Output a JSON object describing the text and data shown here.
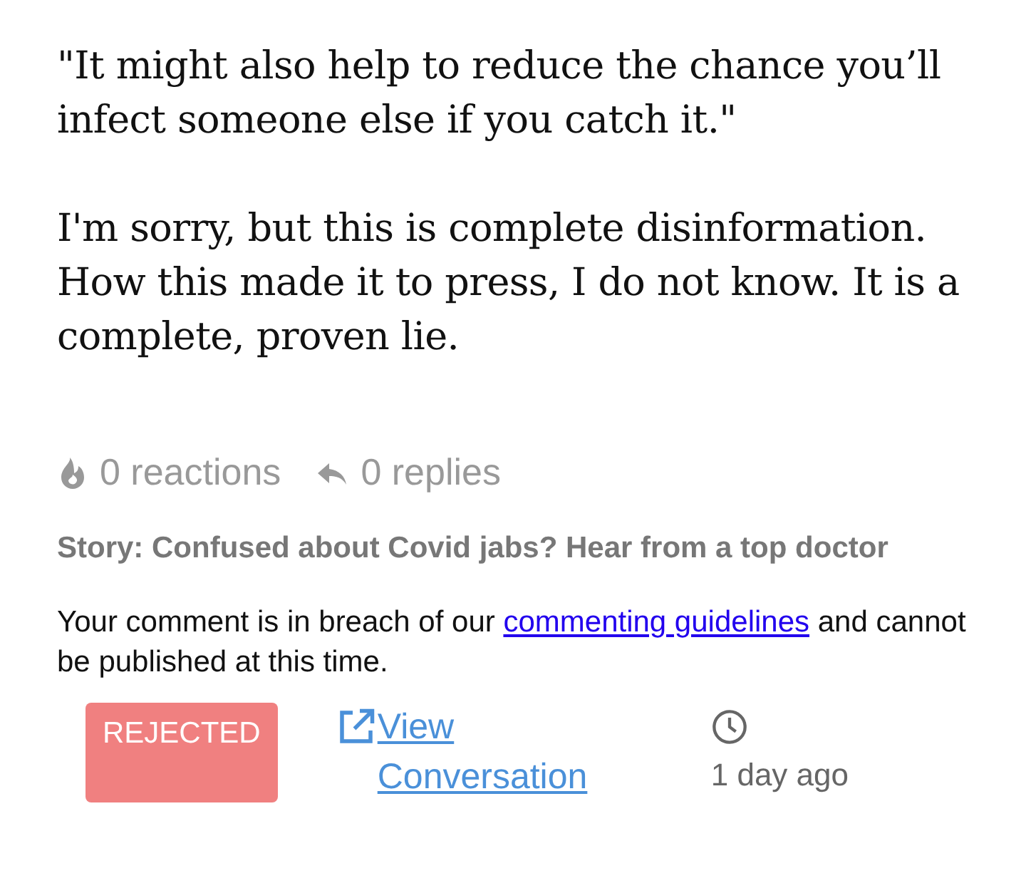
{
  "comment": {
    "paragraphs": [
      "\"It might also help to reduce the chance you’ll infect someone else if you catch it.\"",
      "I'm sorry, but this is complete disinformation. How this made it to press, I do not know. It is a complete, proven lie."
    ]
  },
  "stats": {
    "reactions": "0 reactions",
    "replies": "0 replies"
  },
  "story": "Story: Confused about Covid jabs? Hear from a top doctor",
  "notice": {
    "before": "Your comment is in breach of our ",
    "link": "commenting guidelines",
    "after": " and cannot be published at this time."
  },
  "status": {
    "label": "REJECTED",
    "kind": "rejected"
  },
  "view_link": "View Conversation",
  "time": "1 day ago"
}
